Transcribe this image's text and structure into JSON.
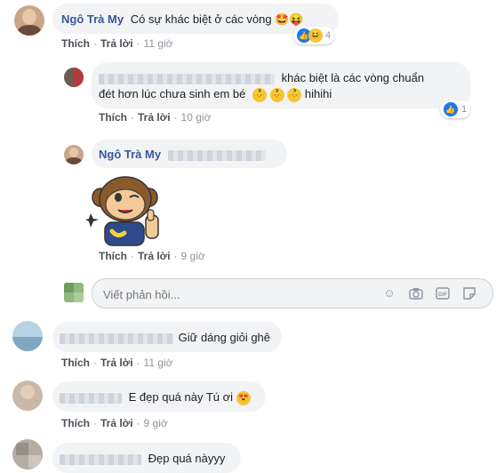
{
  "comments": [
    {
      "name": "Ngô Trà My",
      "text": "Có sự khác biệt ở các vòng",
      "emoji": "🤩😝",
      "reactions": "4",
      "actions": {
        "like": "Thích",
        "reply": "Trả lời",
        "time": "11 giờ"
      }
    },
    {
      "text_line1": "khác biệt là các vòng chuẩn",
      "text_line2": "đét hơn lúc chưa sinh em bé",
      "text_tail": "hihihi",
      "reactions": "1",
      "actions": {
        "like": "Thích",
        "reply": "Trả lời",
        "time": "10 giờ"
      }
    },
    {
      "name": "Ngô Trà My",
      "actions": {
        "like": "Thích",
        "reply": "Trả lời",
        "time": "9 giờ"
      }
    },
    {
      "text": "Giữ dáng giỏi ghê",
      "actions": {
        "like": "Thích",
        "reply": "Trả lời",
        "time": "11 giờ"
      }
    },
    {
      "text": "E đẹp quá này Tú ơi",
      "actions": {
        "like": "Thích",
        "reply": "Trả lời",
        "time": "9 giờ"
      }
    },
    {
      "text": "Đẹp quá nàyyy"
    }
  ],
  "reply_input": {
    "placeholder": "Viết phản hồi..."
  },
  "colors": {
    "link": "#385898",
    "bubble": "#f2f3f5",
    "like_blue": "#1877f2"
  }
}
